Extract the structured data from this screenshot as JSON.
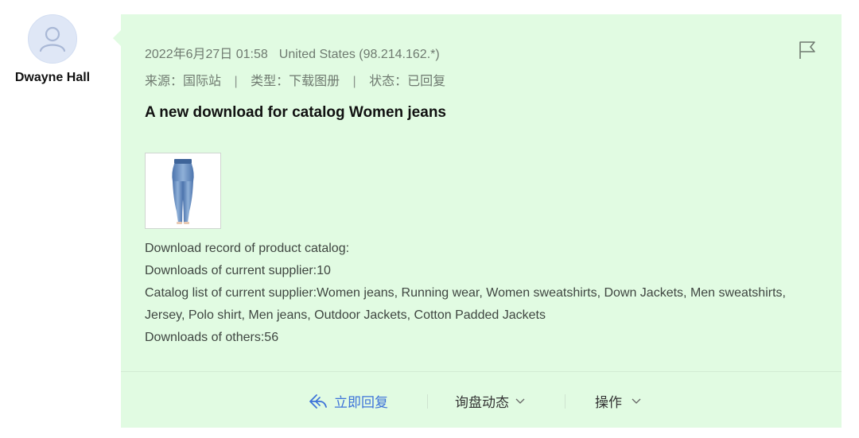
{
  "user": {
    "name": "Dwayne Hall"
  },
  "message": {
    "datetime": "2022年6月27日 01:58",
    "location": "United States (98.214.162.*)",
    "source": "来源：国际站",
    "type": "类型：下载图册",
    "status": "状态：已回复",
    "separator": "|",
    "title": "A new download for catalog Women jeans",
    "desc_line1": "Download record of product catalog:",
    "desc_line2": "Downloads of current supplier:10",
    "desc_line3": "Catalog list of current supplier:Women jeans, Running wear, Women sweatshirts, Down Jackets, Men sweatshirts, Jersey, Polo shirt, Men jeans, Outdoor Jackets, Cotton Padded Jackets",
    "desc_line4": "Downloads of others:56"
  },
  "actions": {
    "reply_label": "立即回复",
    "inquiry_label": "询盘动态",
    "operate_label": "操作"
  },
  "colors": {
    "card_bg": "#e1fbe2",
    "reply_blue": "#3d73d9",
    "meta_gray": "#6f7a70"
  },
  "icons": {
    "avatar": "user-avatar-icon",
    "flag": "flag-icon",
    "reply": "reply-arrow-icon",
    "chevron": "chevron-down-icon",
    "product": "jeans-product-thumbnail"
  }
}
